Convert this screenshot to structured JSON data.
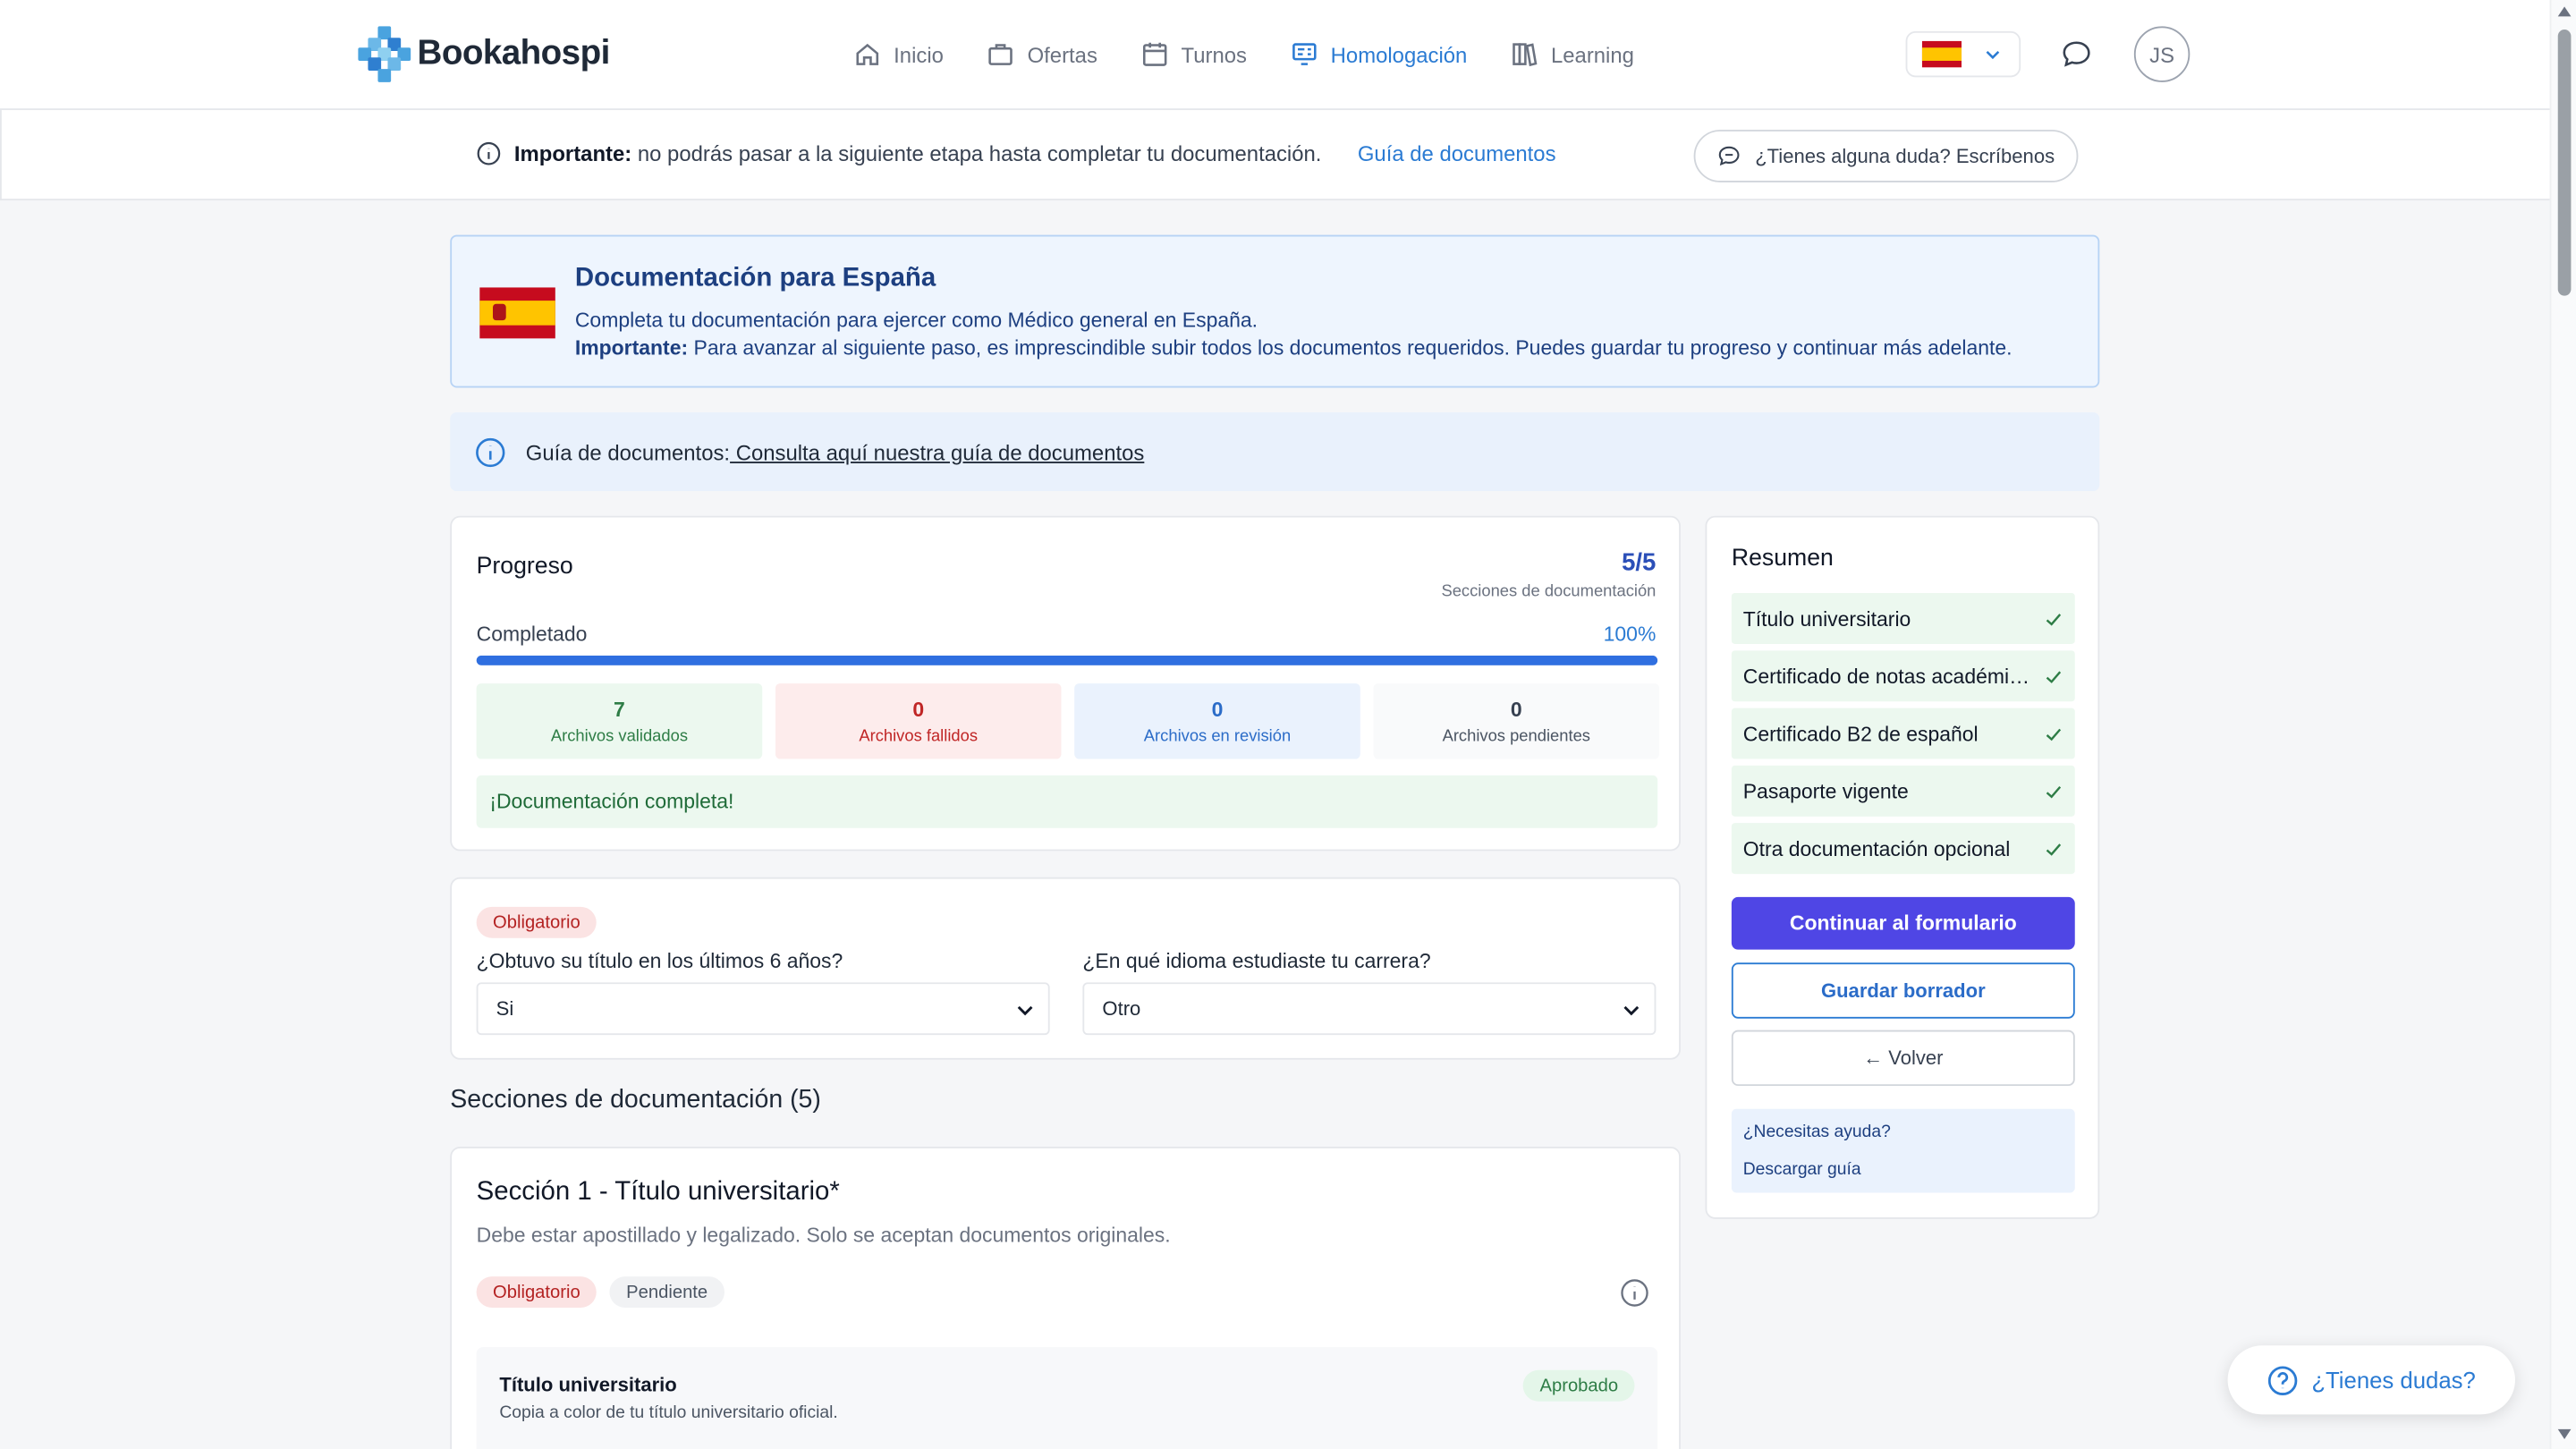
{
  "header": {
    "brand": "Bookahospi",
    "nav": [
      {
        "label": "Inicio",
        "icon": "home-icon"
      },
      {
        "label": "Ofertas",
        "icon": "briefcase-icon"
      },
      {
        "label": "Turnos",
        "icon": "calendar-icon"
      },
      {
        "label": "Homologación",
        "icon": "homologation-icon",
        "active": true
      },
      {
        "label": "Learning",
        "icon": "books-icon"
      }
    ],
    "language_flag": "flag-spain-icon",
    "avatar_initials": "JS"
  },
  "notice": {
    "strong": "Importante:",
    "text": "no podrás pasar a la siguiente etapa hasta completar tu documentación.",
    "link": "Guía de documentos",
    "doubt_button": "¿Tienes alguna duda? Escríbenos"
  },
  "spain_card": {
    "title": "Documentación para España",
    "subtitle": "Completa tu documentación para ejercer como Médico general en España.",
    "important_label": "Importante:",
    "important_text": "Para avanzar al siguiente paso, es imprescindible subir todos los documentos requeridos. Puedes guardar tu progreso y continuar más adelante."
  },
  "guide_bar": {
    "label": "Guía de documentos:",
    "link": " Consulta aquí nuestra guía de documentos"
  },
  "progress": {
    "title": "Progreso",
    "count": "5/5",
    "count_label": "Secciones de documentación",
    "completed_label": "Completado",
    "percent_label": "100%",
    "percent_value": 1.0,
    "stats": [
      {
        "value": "7",
        "label": "Archivos validados"
      },
      {
        "value": "0",
        "label": "Archivos fallidos"
      },
      {
        "value": "0",
        "label": "Archivos en revisión"
      },
      {
        "value": "0",
        "label": "Archivos pendientes"
      }
    ],
    "complete_message": "¡Documentación completa!"
  },
  "questions": {
    "badge": "Obligatorio",
    "q1_label": "¿Obtuvo su título en los últimos 6 años?",
    "q1_value": "Si",
    "q2_label": "¿En qué idioma estudiaste tu carrera?",
    "q2_value": "Otro"
  },
  "sections": {
    "heading": "Secciones de documentación (5)",
    "section1": {
      "title": "Sección 1 - Título universitario*",
      "description": "Debe estar apostillado y legalizado. Solo se aceptan documentos originales.",
      "badge_required": "Obligatorio",
      "badge_status": "Pendiente",
      "file": {
        "title": "Título universitario",
        "description": "Copia a color de tu título universitario oficial.",
        "status": "Aprobado"
      }
    }
  },
  "summary": {
    "title": "Resumen",
    "items": [
      "Título universitario",
      "Certificado de notas académicas",
      "Certificado B2 de español",
      "Pasaporte vigente",
      "Otra documentación opcional"
    ],
    "continue_button": "Continuar al formulario",
    "save_button": "Guardar borrador",
    "back_button": "← Volver",
    "help_link": "¿Necesitas ayuda?",
    "download_link": "Descargar guía"
  },
  "fab": {
    "label": "¿Tienes dudas?"
  },
  "colors": {
    "accent": "#2b7bd3",
    "primary_button": "#4f46e5",
    "success_bg": "#ecf8ef"
  }
}
